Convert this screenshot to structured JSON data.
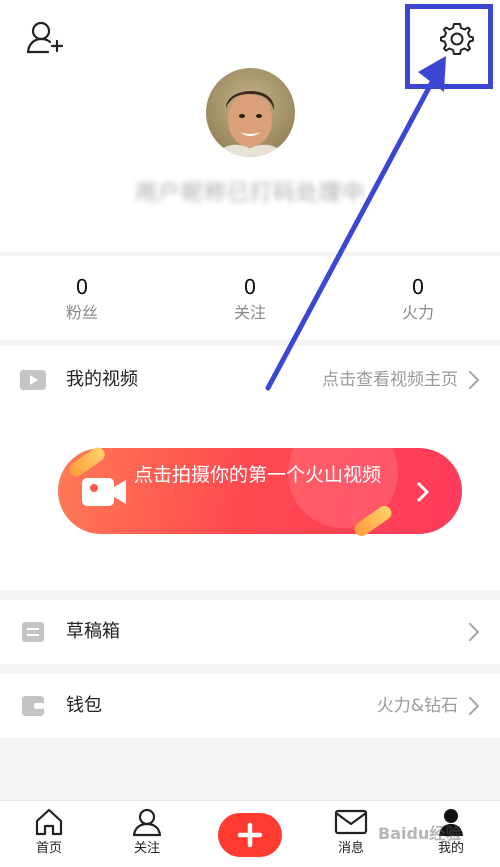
{
  "profile": {
    "username": "用户昵称已打码处理中"
  },
  "stats": [
    {
      "value": "0",
      "label": "粉丝"
    },
    {
      "value": "0",
      "label": "关注"
    },
    {
      "value": "0",
      "label": "火力"
    }
  ],
  "my_videos": {
    "title": "我的视频",
    "hint": "点击查看视频主页"
  },
  "shoot_button": {
    "label": "点击拍摄你的第一个火山视频"
  },
  "drafts": {
    "title": "草稿箱"
  },
  "wallet": {
    "title": "钱包",
    "hint": "火力&钻石"
  },
  "bottom_nav": {
    "home": "首页",
    "follow": "关注",
    "messages": "消息",
    "mine": "我的"
  },
  "watermark": "Baidu经验",
  "icons": {
    "add_friend": "add-friend-icon",
    "settings": "gear-icon",
    "play": "play-icon",
    "camera": "camera-icon",
    "draft": "draft-icon",
    "wallet": "wallet-icon",
    "home": "home-icon",
    "follow": "follow-icon",
    "plus": "plus-icon",
    "message": "message-icon",
    "mine": "profile-icon"
  },
  "colors": {
    "accent_red": "#ff3b30",
    "annotation_blue": "#3b46d3",
    "gradient_start": "#ff7a56",
    "gradient_end": "#ff3b5c"
  }
}
